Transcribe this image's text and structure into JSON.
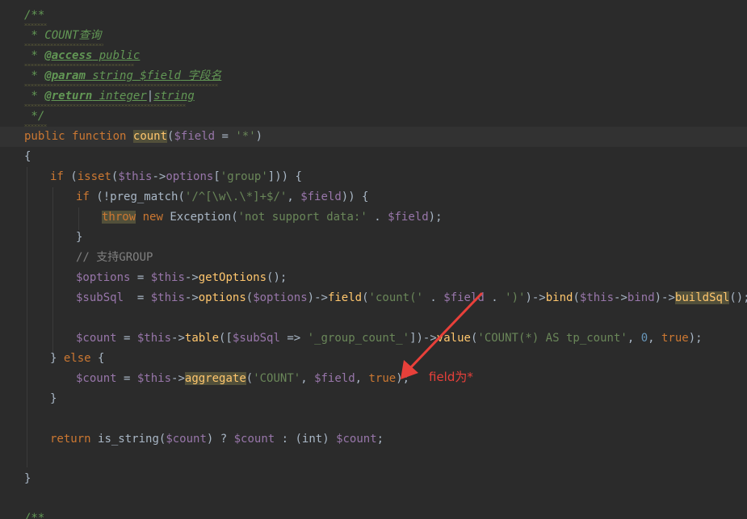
{
  "colors": {
    "background": "#2b2b2b",
    "current_line": "#323232",
    "keyword": "#cc7832",
    "variable": "#9876aa",
    "string": "#6a8759",
    "number": "#6897bb",
    "comment": "#808080",
    "doc_comment": "#629755",
    "function_decl": "#ffc66d",
    "annotation": "#e8403a"
  },
  "doc": {
    "open": "/**",
    "line_count": " * COUNT查询",
    "star": " * ",
    "tag_access": "@access",
    "access_value": " public",
    "tag_param": "@param",
    "param_type": " string ",
    "param_var": "$field",
    "param_desc": " 字段名",
    "tag_return": "@return",
    "return_type1": " integer",
    "return_sep": "|",
    "return_type2": "string",
    "close": " */"
  },
  "code": {
    "kw_public": "public",
    "kw_function": "function",
    "fn_name": "count",
    "var_field": "$field",
    "var_this": "$this",
    "var_options": "$options",
    "var_subSql": "$subSql",
    "var_count": "$count",
    "str_star": "'*'",
    "brace_open": "{",
    "brace_close": "}",
    "kw_if": "if",
    "kw_isset": "isset",
    "kw_else": "else",
    "kw_throw": "throw",
    "kw_new": "new",
    "kw_return": "return",
    "kw_true": "true",
    "cls_exception": "Exception",
    "fn_preg_match": "preg_match",
    "fn_getOptions": "getOptions",
    "fn_options": "options",
    "fn_field": "field",
    "fn_bind": "bind",
    "fn_buildSql": "buildSql",
    "fn_table": "table",
    "fn_value": "value",
    "fn_aggregate": "aggregate",
    "fn_is_string": "is_string",
    "prop_options": "options",
    "prop_bind": "bind",
    "str_group": "'group'",
    "str_regex": "'/^[\\w\\.\\*]+$/'",
    "str_not_support": "'not support data:'",
    "comment_group": "// 支持GROUP",
    "str_count_open": "'count('",
    "str_close_paren": "')'",
    "str_group_count": "'_group_count_'",
    "str_count_as": "'COUNT(*) AS tp_count'",
    "num_zero": "0",
    "str_COUNT": "'COUNT'",
    "cast_int": "(int)"
  },
  "annotation": {
    "label": "field为*"
  }
}
